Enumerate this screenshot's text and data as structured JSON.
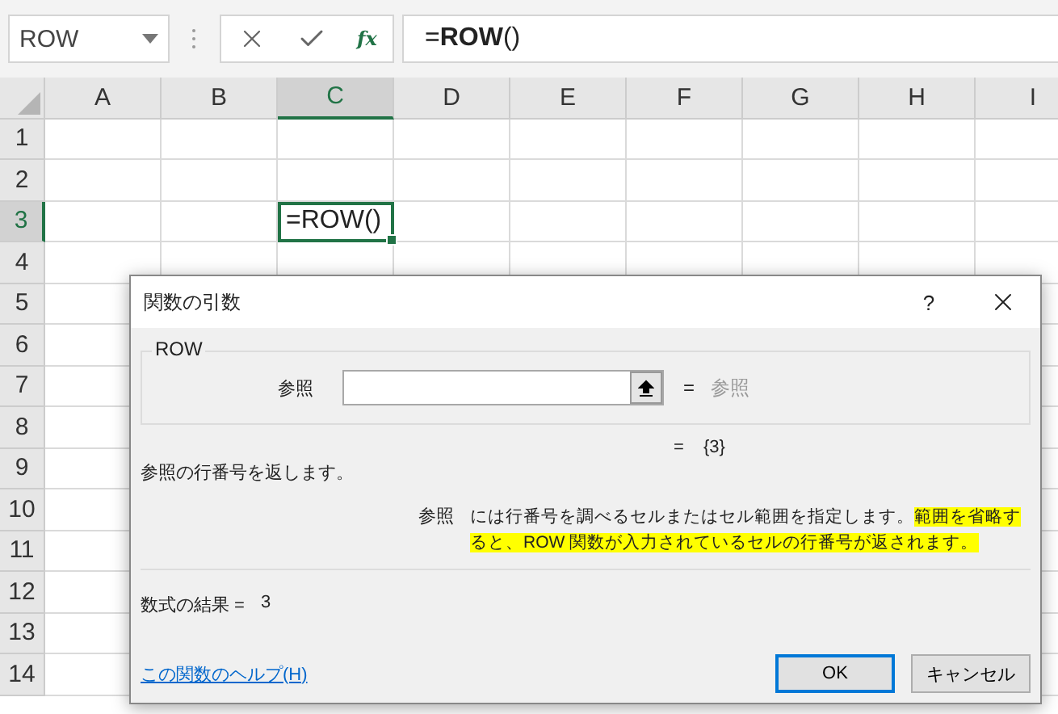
{
  "name_box": {
    "value": "ROW"
  },
  "formula_bar": {
    "function_label": "fx",
    "value": "=**ROW**()"
  },
  "columns": [
    {
      "label": "A",
      "selected": false
    },
    {
      "label": "B",
      "selected": false
    },
    {
      "label": "C",
      "selected": true
    },
    {
      "label": "D",
      "selected": false
    },
    {
      "label": "E",
      "selected": false
    },
    {
      "label": "F",
      "selected": false
    },
    {
      "label": "G",
      "selected": false
    },
    {
      "label": "H",
      "selected": false
    },
    {
      "label": "I",
      "selected": false
    }
  ],
  "rows": [
    {
      "label": "1",
      "selected": false
    },
    {
      "label": "2",
      "selected": false
    },
    {
      "label": "3",
      "selected": true,
      "active_cell": "=ROW()"
    },
    {
      "label": "4",
      "selected": false
    },
    {
      "label": "5",
      "selected": false
    },
    {
      "label": "6",
      "selected": false
    },
    {
      "label": "7",
      "selected": false
    },
    {
      "label": "8",
      "selected": false
    },
    {
      "label": "9",
      "selected": false
    },
    {
      "label": "10",
      "selected": false
    },
    {
      "label": "11",
      "selected": false
    },
    {
      "label": "12",
      "selected": false
    },
    {
      "label": "13",
      "selected": false
    },
    {
      "label": "14",
      "selected": false
    }
  ],
  "dialog": {
    "title": "関数の引数",
    "help": "?",
    "group_label": "ROW",
    "argument": {
      "label": "参照",
      "equals": "=",
      "preview": "参照"
    },
    "result_equals": "=",
    "result_value": "{3}",
    "description": "参照の行番号を返します。",
    "argument_help": {
      "label": "参照",
      "segments": [
        {
          "text": "には行番号を調べるセルまたはセル範囲を指定します。",
          "highlighted": false
        },
        {
          "text": "範囲を省略すると、ROW 関数が入力されているセルの行番号が返されます。",
          "highlighted": true
        }
      ]
    },
    "formula_result_label": "数式の結果 =",
    "formula_result_value": "3",
    "help_link": "この関数のヘルプ(H)",
    "buttons": [
      {
        "label": "OK",
        "selected": true
      },
      {
        "label": "キャンセル",
        "selected": false
      }
    ]
  }
}
